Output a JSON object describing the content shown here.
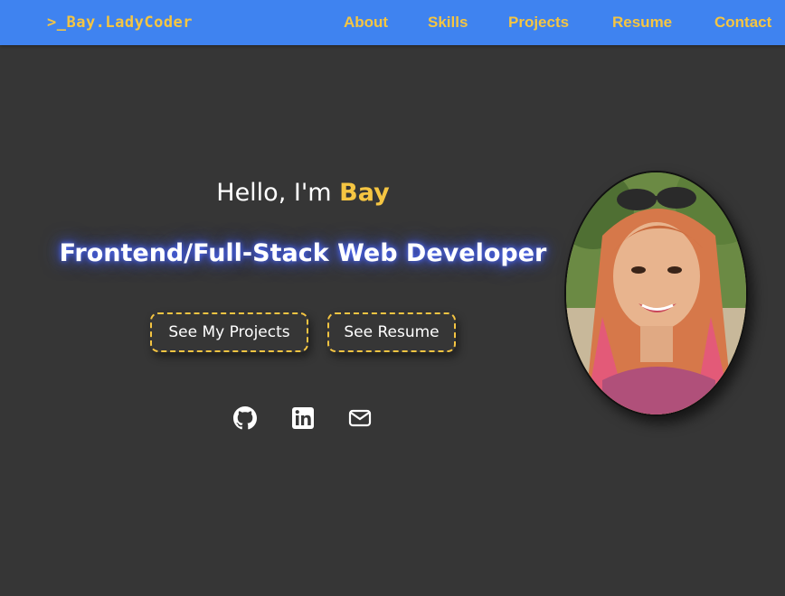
{
  "nav": {
    "brand": ">_Bay.LadyCoder",
    "links": [
      "About",
      "Skills",
      "Projects",
      "Resume",
      "Contact"
    ]
  },
  "hero": {
    "greeting": "Hello, I'm ",
    "name": "Bay",
    "title": "Frontend/Full-Stack Web Developer",
    "buttons": {
      "projects": "See My Projects",
      "resume": "See Resume"
    }
  },
  "social": [
    "github-icon",
    "linkedin-icon",
    "envelope-icon"
  ],
  "colors": {
    "navbar": "#3f83f0",
    "accent": "#f5c542",
    "background": "#363636",
    "text": "#ffffff"
  }
}
